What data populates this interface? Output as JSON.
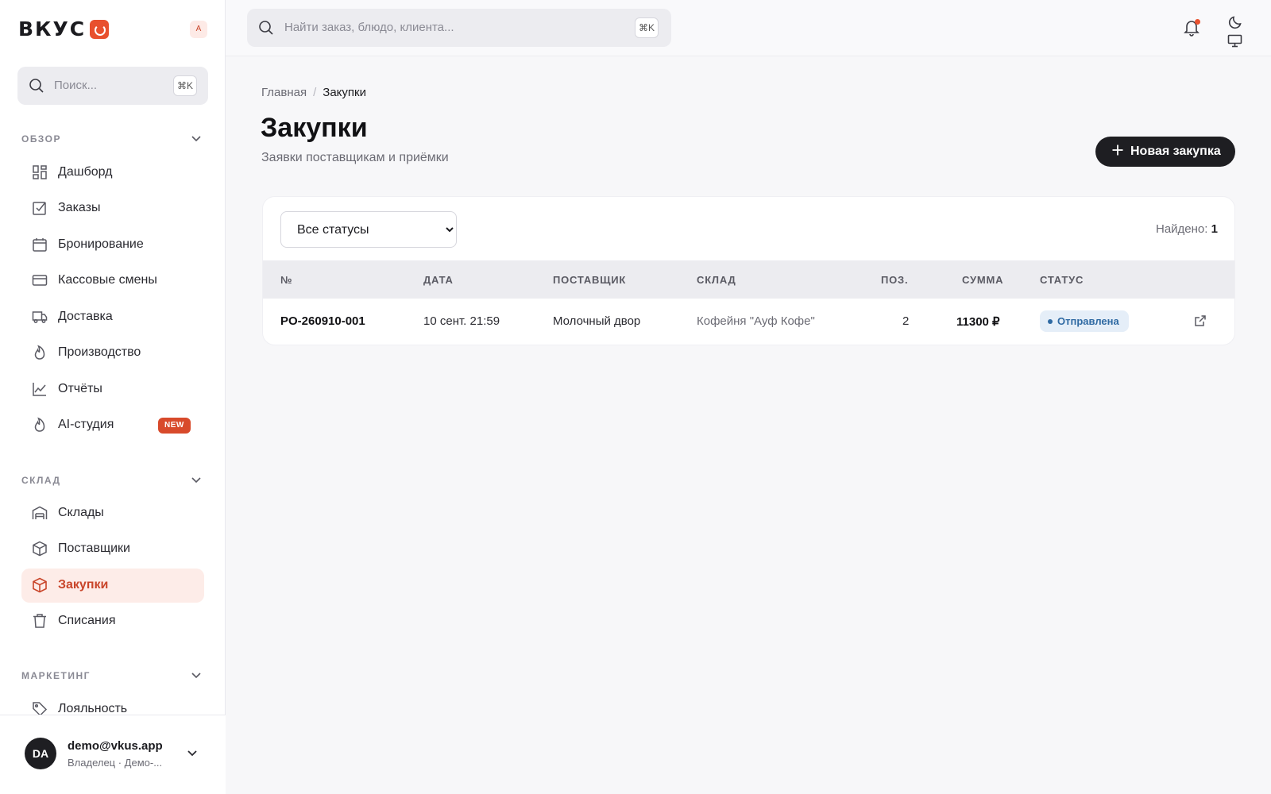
{
  "brand": {
    "name": "ВКУС",
    "lang_badge": "A",
    "accent": "#e8502e"
  },
  "sidebar": {
    "search": {
      "placeholder": "Поиск...",
      "shortcut": "⌘K"
    },
    "groups": [
      {
        "title": "ОБЗОР",
        "items": [
          {
            "label": "Дашборд",
            "icon": "dashboard-icon"
          },
          {
            "label": "Заказы",
            "icon": "checkbox-icon"
          },
          {
            "label": "Бронирование",
            "icon": "calendar-icon"
          },
          {
            "label": "Кассовые смены",
            "icon": "card-icon"
          },
          {
            "label": "Доставка",
            "icon": "truck-icon"
          },
          {
            "label": "Производство",
            "icon": "flame-icon"
          },
          {
            "label": "Отчёты",
            "icon": "chart-icon"
          },
          {
            "label": "AI-студия",
            "icon": "flame-icon",
            "badge": "NEW"
          }
        ]
      },
      {
        "title": "СКЛАД",
        "items": [
          {
            "label": "Склады",
            "icon": "warehouse-icon"
          },
          {
            "label": "Поставщики",
            "icon": "box-icon"
          },
          {
            "label": "Закупки",
            "icon": "box-icon",
            "active": true
          },
          {
            "label": "Списания",
            "icon": "trash-icon"
          }
        ]
      },
      {
        "title": "МАРКЕТИНГ",
        "items": [
          {
            "label": "Лояльность",
            "icon": "tag-icon"
          }
        ]
      }
    ],
    "user": {
      "initials": "DA",
      "email": "demo@vkus.app",
      "role": "Владелец · Демо-..."
    }
  },
  "topbar": {
    "search_placeholder": "Найти заказ, блюдо, клиента...",
    "shortcut": "⌘K"
  },
  "breadcrumb": {
    "home": "Главная",
    "separator": "/",
    "current": "Закупки"
  },
  "page": {
    "title": "Закупки",
    "subtitle": "Заявки поставщикам и приёмки",
    "new_button": "Новая закупка"
  },
  "filter": {
    "selected": "Все статусы",
    "found_label": "Найдено:",
    "found_count": "1"
  },
  "table": {
    "columns": [
      "№",
      "ДАТА",
      "ПОСТАВЩИК",
      "СКЛАД",
      "ПОЗ.",
      "СУММА",
      "СТАТУС"
    ],
    "rows": [
      {
        "number": "PO-260910-001",
        "date": "10 сент. 21:59",
        "supplier": "Молочный двор",
        "warehouse": "Кофейня \"Ауф Кофе\"",
        "positions": "2",
        "sum": "11300 ₽",
        "status": "Отправлена"
      }
    ]
  }
}
